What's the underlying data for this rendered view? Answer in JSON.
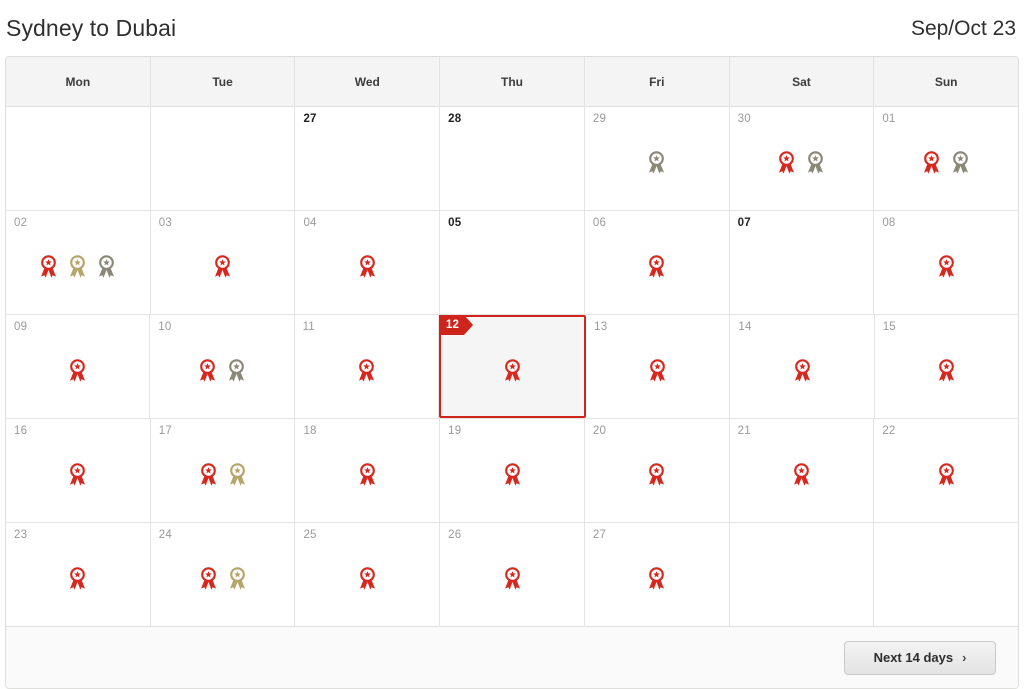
{
  "header": {
    "route_title": "Sydney to Dubai",
    "month_range": "Sep/Oct 23"
  },
  "calendar": {
    "weekdays": [
      "Mon",
      "Tue",
      "Wed",
      "Thu",
      "Fri",
      "Sat",
      "Sun"
    ],
    "award_colors": {
      "red": "#d6281f",
      "gold": "#b5a46c",
      "grey": "#8b8877"
    },
    "selected_day": "12",
    "weeks": [
      {
        "days": [
          {
            "label": "",
            "strong": false,
            "awards": [],
            "selected": false,
            "empty": true
          },
          {
            "label": "",
            "strong": false,
            "awards": [],
            "selected": false,
            "empty": true
          },
          {
            "label": "27",
            "strong": true,
            "awards": [],
            "selected": false,
            "empty": false
          },
          {
            "label": "28",
            "strong": true,
            "awards": [],
            "selected": false,
            "empty": false
          },
          {
            "label": "29",
            "strong": false,
            "awards": [
              "grey"
            ],
            "selected": false,
            "empty": false
          },
          {
            "label": "30",
            "strong": false,
            "awards": [
              "red",
              "grey"
            ],
            "selected": false,
            "empty": false
          },
          {
            "label": "01",
            "strong": false,
            "awards": [
              "red",
              "grey"
            ],
            "selected": false,
            "empty": false
          }
        ]
      },
      {
        "days": [
          {
            "label": "02",
            "strong": false,
            "awards": [
              "red",
              "gold",
              "grey"
            ],
            "selected": false,
            "empty": false
          },
          {
            "label": "03",
            "strong": false,
            "awards": [
              "red"
            ],
            "selected": false,
            "empty": false
          },
          {
            "label": "04",
            "strong": false,
            "awards": [
              "red"
            ],
            "selected": false,
            "empty": false
          },
          {
            "label": "05",
            "strong": true,
            "awards": [],
            "selected": false,
            "empty": false
          },
          {
            "label": "06",
            "strong": false,
            "awards": [
              "red"
            ],
            "selected": false,
            "empty": false
          },
          {
            "label": "07",
            "strong": true,
            "awards": [],
            "selected": false,
            "empty": false
          },
          {
            "label": "08",
            "strong": false,
            "awards": [
              "red"
            ],
            "selected": false,
            "empty": false
          }
        ]
      },
      {
        "days": [
          {
            "label": "09",
            "strong": false,
            "awards": [
              "red"
            ],
            "selected": false,
            "empty": false
          },
          {
            "label": "10",
            "strong": false,
            "awards": [
              "red",
              "grey"
            ],
            "selected": false,
            "empty": false
          },
          {
            "label": "11",
            "strong": false,
            "awards": [
              "red"
            ],
            "selected": false,
            "empty": false
          },
          {
            "label": "12",
            "strong": false,
            "awards": [
              "red"
            ],
            "selected": true,
            "empty": false
          },
          {
            "label": "13",
            "strong": false,
            "awards": [
              "red"
            ],
            "selected": false,
            "empty": false
          },
          {
            "label": "14",
            "strong": false,
            "awards": [
              "red"
            ],
            "selected": false,
            "empty": false
          },
          {
            "label": "15",
            "strong": false,
            "awards": [
              "red"
            ],
            "selected": false,
            "empty": false
          }
        ]
      },
      {
        "days": [
          {
            "label": "16",
            "strong": false,
            "awards": [
              "red"
            ],
            "selected": false,
            "empty": false
          },
          {
            "label": "17",
            "strong": false,
            "awards": [
              "red",
              "gold"
            ],
            "selected": false,
            "empty": false
          },
          {
            "label": "18",
            "strong": false,
            "awards": [
              "red"
            ],
            "selected": false,
            "empty": false
          },
          {
            "label": "19",
            "strong": false,
            "awards": [
              "red"
            ],
            "selected": false,
            "empty": false
          },
          {
            "label": "20",
            "strong": false,
            "awards": [
              "red"
            ],
            "selected": false,
            "empty": false
          },
          {
            "label": "21",
            "strong": false,
            "awards": [
              "red"
            ],
            "selected": false,
            "empty": false
          },
          {
            "label": "22",
            "strong": false,
            "awards": [
              "red"
            ],
            "selected": false,
            "empty": false
          }
        ]
      },
      {
        "days": [
          {
            "label": "23",
            "strong": false,
            "awards": [
              "red"
            ],
            "selected": false,
            "empty": false
          },
          {
            "label": "24",
            "strong": false,
            "awards": [
              "red",
              "gold"
            ],
            "selected": false,
            "empty": false
          },
          {
            "label": "25",
            "strong": false,
            "awards": [
              "red"
            ],
            "selected": false,
            "empty": false
          },
          {
            "label": "26",
            "strong": false,
            "awards": [
              "red"
            ],
            "selected": false,
            "empty": false
          },
          {
            "label": "27",
            "strong": false,
            "awards": [
              "red"
            ],
            "selected": false,
            "empty": false
          },
          {
            "label": "",
            "strong": false,
            "awards": [],
            "selected": false,
            "empty": true
          },
          {
            "label": "",
            "strong": false,
            "awards": [],
            "selected": false,
            "empty": true
          }
        ]
      }
    ]
  },
  "footer": {
    "next_button_label": "Next 14 days",
    "next_button_chevron": "›"
  }
}
